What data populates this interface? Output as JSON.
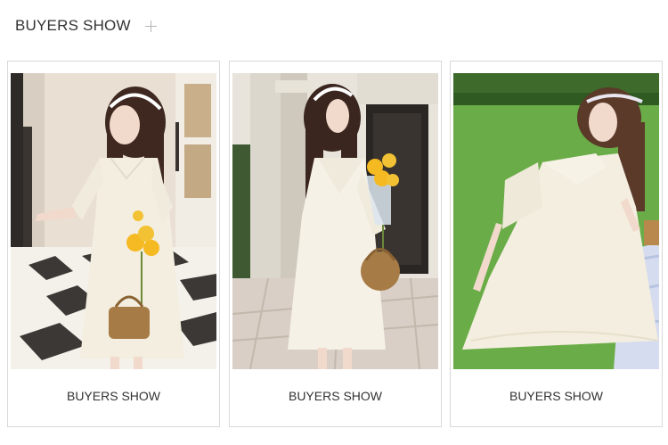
{
  "header": {
    "title": "BUYERS SHOW",
    "add_icon": "plus-icon"
  },
  "cards": [
    {
      "label": "BUYERS SHOW",
      "photo": "model-in-white-dress-checkered-hall"
    },
    {
      "label": "BUYERS SHOW",
      "photo": "model-in-white-dress-by-doorway"
    },
    {
      "label": "BUYERS SHOW",
      "photo": "model-in-white-dress-on-lawn"
    }
  ],
  "colors": {
    "text": "#333333",
    "border": "#d9d9d9",
    "dress": "#f3eedf",
    "hair": "#4a2e22",
    "flowers": "#f5b921",
    "grass": "#5fa33e"
  }
}
